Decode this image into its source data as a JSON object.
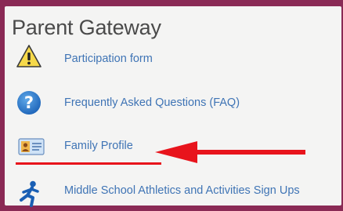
{
  "panel": {
    "title": "Parent Gateway",
    "items": [
      {
        "label": "Participation form",
        "icon": "warning-icon"
      },
      {
        "label": "Frequently Asked Questions (FAQ)",
        "icon": "help-icon"
      },
      {
        "label": "Family Profile",
        "icon": "contact-card-icon"
      },
      {
        "label": "Middle School Athletics and Activities Sign Ups",
        "icon": "runner-icon"
      }
    ]
  },
  "annotation": {
    "highlight_color": "#e8141c",
    "points_to": "Family Profile"
  },
  "colors": {
    "frame": "#8a2a55",
    "panel_bg": "#f4f4f3",
    "link": "#3f74b5",
    "title": "#4a4a4a"
  }
}
